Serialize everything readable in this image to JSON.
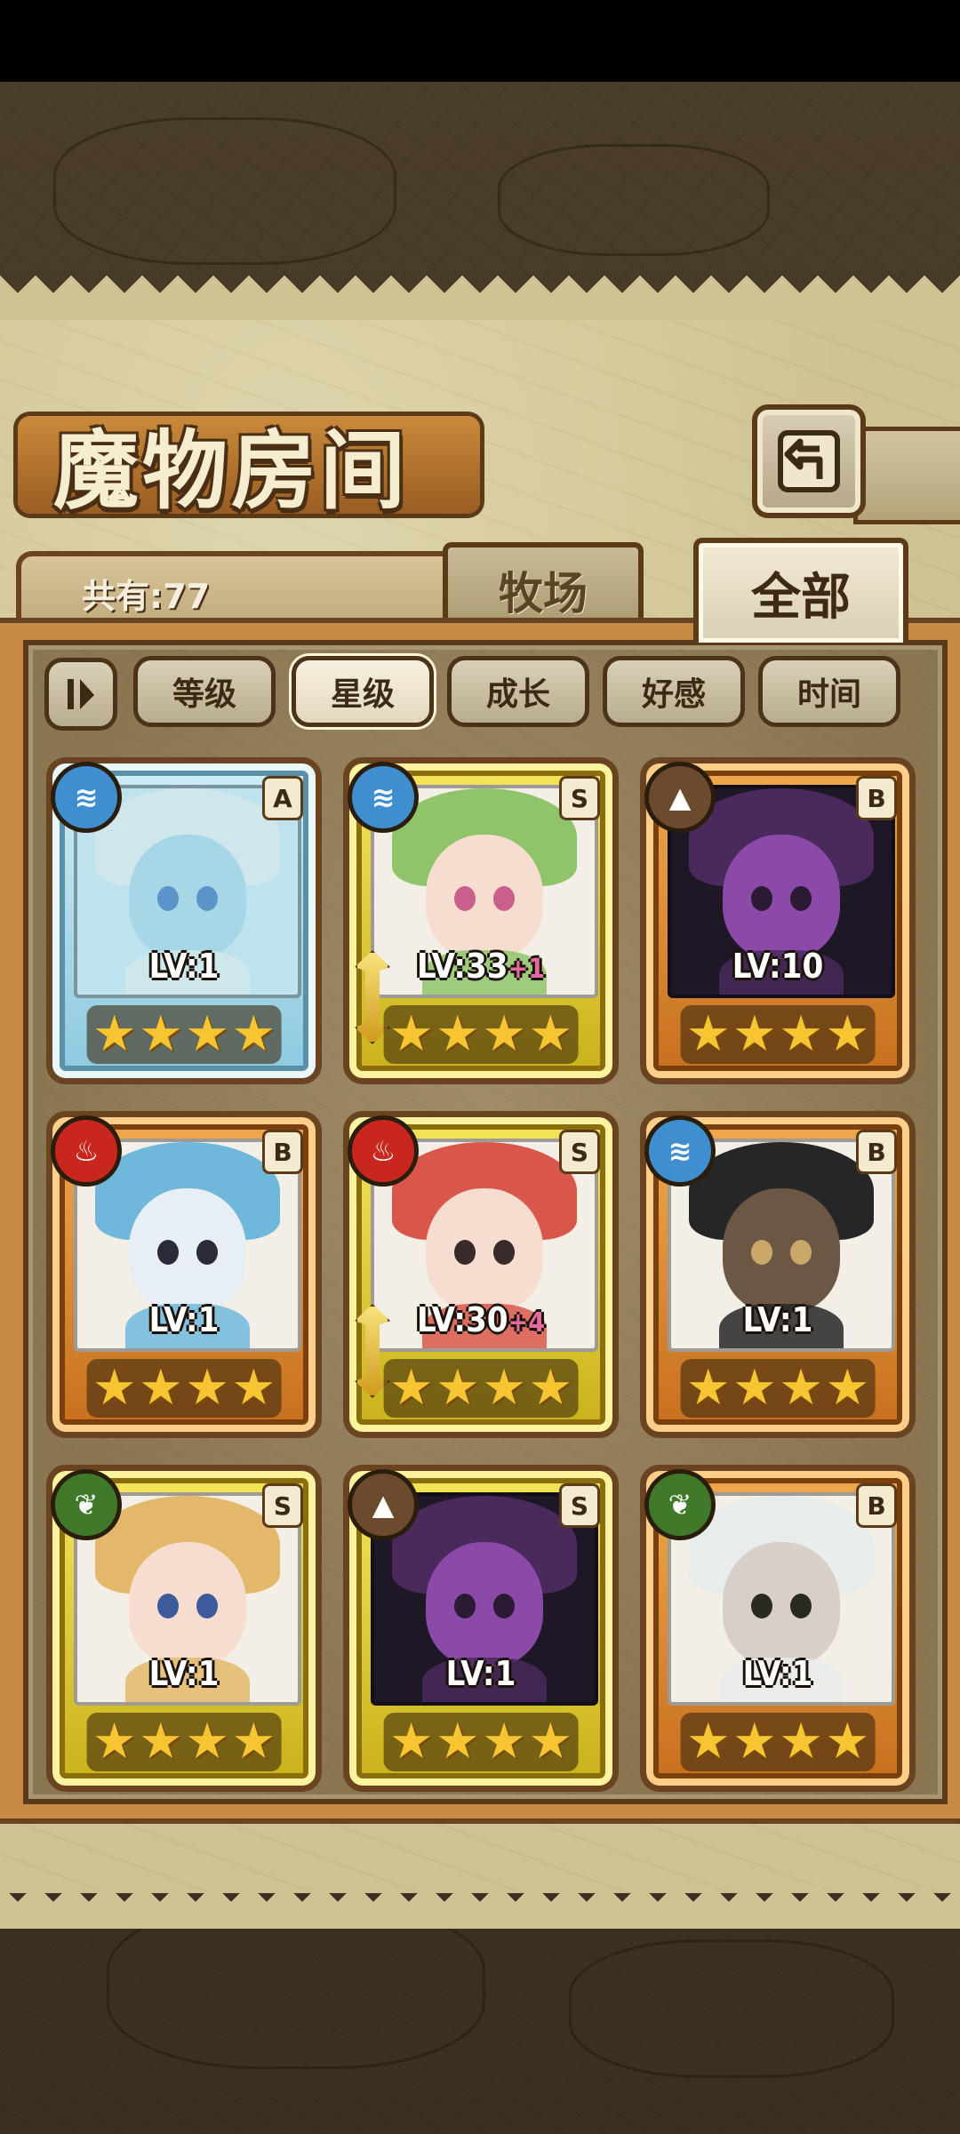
{
  "header": {
    "title": "魔物房间",
    "count_label": "共有:77"
  },
  "tabs": [
    {
      "label": "牧场",
      "selected": false
    },
    {
      "label": "全部",
      "selected": true
    }
  ],
  "sort": {
    "toggle_icon": "sort-order-icon",
    "buttons": [
      {
        "label": "等级",
        "selected": false
      },
      {
        "label": "星级",
        "selected": true
      },
      {
        "label": "成长",
        "selected": false
      },
      {
        "label": "好感",
        "selected": false
      },
      {
        "label": "时间",
        "selected": false
      }
    ]
  },
  "monsters": [
    {
      "element": "water",
      "rank": "A",
      "level": "LV:1",
      "bonus": "",
      "stars": 4,
      "frame": "blue",
      "equipped": false
    },
    {
      "element": "water",
      "rank": "S",
      "level": "LV:33",
      "bonus": "+1",
      "stars": 4,
      "frame": "gold",
      "equipped": true
    },
    {
      "element": "earth",
      "rank": "B",
      "level": "LV:10",
      "bonus": "",
      "stars": 4,
      "frame": "orange",
      "equipped": false
    },
    {
      "element": "fire",
      "rank": "B",
      "level": "LV:1",
      "bonus": "",
      "stars": 4,
      "frame": "orange",
      "equipped": false
    },
    {
      "element": "fire",
      "rank": "S",
      "level": "LV:30",
      "bonus": "+4",
      "stars": 4,
      "frame": "gold",
      "equipped": true
    },
    {
      "element": "water",
      "rank": "B",
      "level": "LV:1",
      "bonus": "",
      "stars": 4,
      "frame": "orange",
      "equipped": false
    },
    {
      "element": "wind",
      "rank": "S",
      "level": "LV:1",
      "bonus": "",
      "stars": 4,
      "frame": "gold",
      "equipped": false
    },
    {
      "element": "earth",
      "rank": "S",
      "level": "LV:1",
      "bonus": "",
      "stars": 4,
      "frame": "gold",
      "equipped": false
    },
    {
      "element": "wind",
      "rank": "B",
      "level": "LV:1",
      "bonus": "",
      "stars": 4,
      "frame": "orange",
      "equipped": false
    }
  ],
  "colors": {
    "water": "#3f8fd0",
    "fire": "#c9271e",
    "earth": "#6b4a2e",
    "wind": "#3f7a2a"
  }
}
